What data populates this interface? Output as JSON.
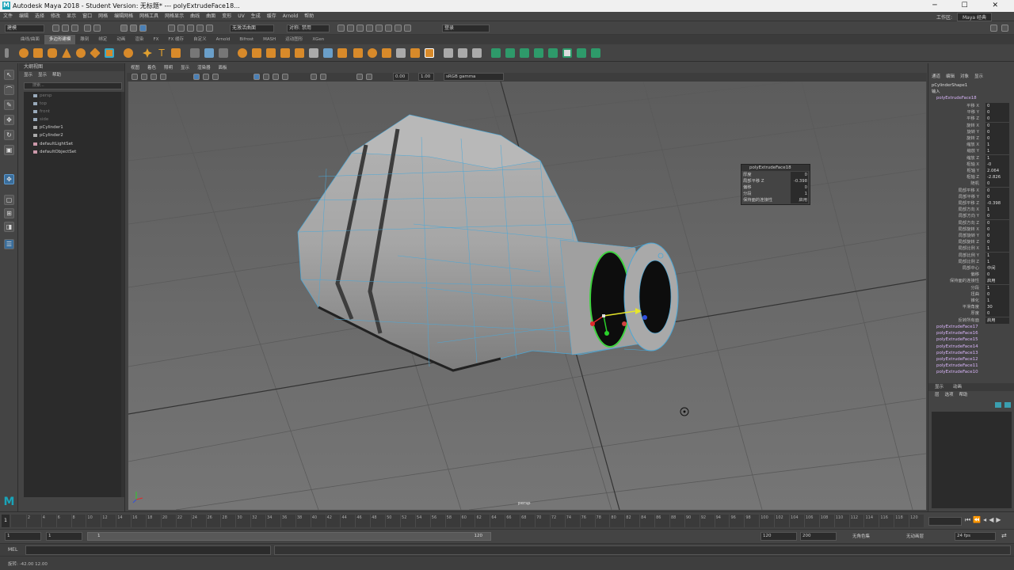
{
  "window": {
    "title": "Autodesk Maya 2018 - Student Version: 无标题*   ---   polyExtrudeFace18...",
    "controls": "─ ☐ ✕"
  },
  "menubar": {
    "items": [
      "文件",
      "编辑",
      "选择",
      "修改",
      "显示",
      "窗口",
      "网格",
      "编辑网格",
      "网格工具",
      "网格显示",
      "曲线",
      "曲面",
      "变形",
      "UV",
      "生成",
      "缓存",
      "Arnold",
      "帮助"
    ],
    "workspace_label": "工作区:",
    "workspace_value": "Maya 经典"
  },
  "statusline": {
    "mode_menu": "建模",
    "live_surface": "无激活曲面",
    "symmetry": "对称: 禁用",
    "login": "登录"
  },
  "shelf_tabs": [
    "曲线/曲面",
    "多边形建模",
    "雕刻",
    "绑定",
    "动画",
    "渲染",
    "FX",
    "FX 缓存",
    "自定义",
    "Arnold",
    "Bifrost",
    "MASH",
    "运动图形",
    "XGen"
  ],
  "shelf_active": "多边形建模",
  "outliner": {
    "title": "大纲视图",
    "menu": [
      "显示",
      "显示",
      "帮助"
    ],
    "search_placeholder": "搜索...",
    "items": [
      {
        "label": "persp",
        "dim": true
      },
      {
        "label": "top",
        "dim": true
      },
      {
        "label": "front",
        "dim": true
      },
      {
        "label": "side",
        "dim": true
      },
      {
        "label": "pCylinder1",
        "dim": false
      },
      {
        "label": "pCylinder2",
        "dim": false
      },
      {
        "label": "defaultLightSet",
        "dim": false
      },
      {
        "label": "defaultObjectSet",
        "dim": false
      }
    ]
  },
  "viewport": {
    "menu": [
      "视图",
      "着色",
      "照明",
      "显示",
      "渲染器",
      "面板"
    ],
    "field_a": "0.00",
    "field_b": "1.00",
    "color_space": "sRGB gamma",
    "camera_label": "persp"
  },
  "floating_window": {
    "title": "polyExtrudeFace18",
    "rows": [
      {
        "name": "厚度",
        "value": "0"
      },
      {
        "name": "局部平移 Z",
        "value": "-0.398"
      },
      {
        "name": "偏移",
        "value": "0"
      },
      {
        "name": "分段",
        "value": "1"
      },
      {
        "name": "保持面的连接性",
        "value": "启用"
      }
    ]
  },
  "channel_box": {
    "menu": [
      "通道",
      "编辑",
      "对象",
      "显示"
    ],
    "shape": "pCylinderShape1",
    "inputs_label": "输入",
    "node": "polyExtrudeFace18",
    "channels": [
      {
        "name": "平移 X",
        "value": "0"
      },
      {
        "name": "平移 Y",
        "value": "0"
      },
      {
        "name": "平移 Z",
        "value": "0"
      },
      {
        "name": "旋转 X",
        "value": "0"
      },
      {
        "name": "旋转 Y",
        "value": "0"
      },
      {
        "name": "旋转 Z",
        "value": "0"
      },
      {
        "name": "缩放 X",
        "value": "1"
      },
      {
        "name": "缩放 Y",
        "value": "1"
      },
      {
        "name": "缩放 Z",
        "value": "1"
      },
      {
        "name": "枢轴 X",
        "value": "-0"
      },
      {
        "name": "枢轴 Y",
        "value": "2.064"
      },
      {
        "name": "枢轴 Z",
        "value": "-2.826"
      },
      {
        "name": "随机",
        "value": "0"
      },
      {
        "name": "局部平移 X",
        "value": "0"
      },
      {
        "name": "局部平移 Y",
        "value": "0"
      },
      {
        "name": "局部平移 Z",
        "value": "-0.398"
      },
      {
        "name": "局部方向 X",
        "value": "1"
      },
      {
        "name": "局部方向 Y",
        "value": "0"
      },
      {
        "name": "局部方向 Z",
        "value": "0"
      },
      {
        "name": "局部旋转 X",
        "value": "0"
      },
      {
        "name": "局部旋转 Y",
        "value": "0"
      },
      {
        "name": "局部旋转 Z",
        "value": "0"
      },
      {
        "name": "局部比例 X",
        "value": "1"
      },
      {
        "name": "局部比例 Y",
        "value": "1"
      },
      {
        "name": "局部比例 Z",
        "value": "1"
      },
      {
        "name": "局部中心",
        "value": "中间"
      },
      {
        "name": "偏移",
        "value": "0"
      },
      {
        "name": "保持面的连接性",
        "value": "启用"
      },
      {
        "name": "分段",
        "value": "1"
      },
      {
        "name": "扭曲",
        "value": "0"
      },
      {
        "name": "锥化",
        "value": "1"
      },
      {
        "name": "平滑角度",
        "value": "30"
      },
      {
        "name": "厚度",
        "value": "0"
      },
      {
        "name": "反转所有面",
        "value": "启用"
      }
    ],
    "history": [
      "polyExtrudeFace17",
      "polyExtrudeFace16",
      "polyExtrudeFace15",
      "polyExtrudeFace14",
      "polyExtrudeFace13",
      "polyExtrudeFace12",
      "polyExtrudeFace11",
      "polyExtrudeFace10"
    ]
  },
  "layer_editor": {
    "tabs": [
      "显示",
      "动画"
    ],
    "menu": [
      "层",
      "选项",
      "帮助"
    ]
  },
  "timeline": {
    "ticks": [
      "2",
      "4",
      "6",
      "8",
      "10",
      "12",
      "14",
      "16",
      "18",
      "20",
      "22",
      "24",
      "26",
      "28",
      "30",
      "32",
      "34",
      "36",
      "38",
      "40",
      "42",
      "44",
      "46",
      "48",
      "50",
      "52",
      "54",
      "56",
      "58",
      "60",
      "62",
      "64",
      "66",
      "68",
      "70",
      "72",
      "74",
      "76",
      "78",
      "80",
      "82",
      "84",
      "86",
      "88",
      "90",
      "92",
      "94",
      "96",
      "98",
      "100",
      "102",
      "104",
      "106",
      "108",
      "110",
      "112",
      "114",
      "116",
      "118",
      "120"
    ],
    "current_frame": "1"
  },
  "range": {
    "start": "1",
    "playback_start": "1",
    "slider_start": "1",
    "slider_end": "120",
    "playback_end": "120",
    "end": "200",
    "character_set": "无角色集",
    "anim_layer": "无动画层",
    "fps": "24 fps"
  },
  "command_line": {
    "label": "MEL"
  },
  "help_line": {
    "text": "旋转: -42.00     12.00"
  }
}
